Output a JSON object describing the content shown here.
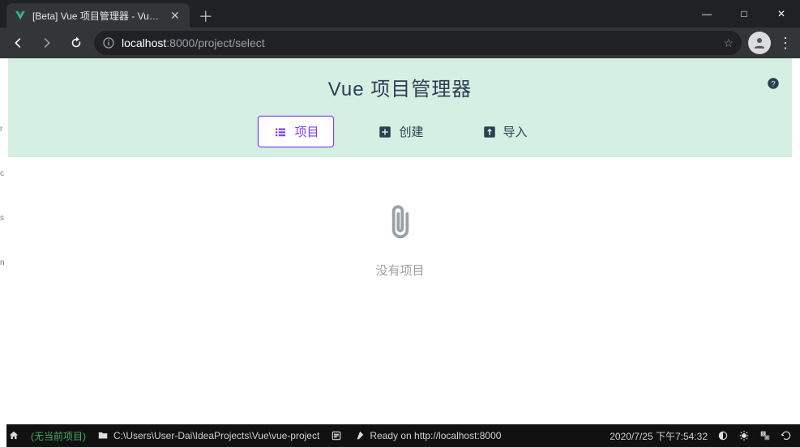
{
  "browser": {
    "tab_title": "[Beta] Vue 项目管理器 - Vue CL",
    "new_tab_glyph": "＋",
    "win": {
      "min": "—",
      "max": "□",
      "close": "✕"
    },
    "url": {
      "host_main": "localhost",
      "host_port": ":8000",
      "path": "/project/select"
    },
    "star": "☆",
    "kebab": "⋮"
  },
  "page": {
    "title": "Vue 项目管理器",
    "tabs": {
      "projects": "项目",
      "create": "创建",
      "import": "导入"
    },
    "empty_text": "没有项目"
  },
  "statusbar": {
    "no_project": "(无当前项目)",
    "path": "C:\\Users\\User-Dai\\IdeaProjects\\Vue\\vue-project",
    "ready": "Ready on http://localhost:8000",
    "datetime": "2020/7/25 下午7:54:32"
  },
  "left_edge": {
    "a": "r",
    "b": "c",
    "c": "s",
    "d": "n"
  }
}
